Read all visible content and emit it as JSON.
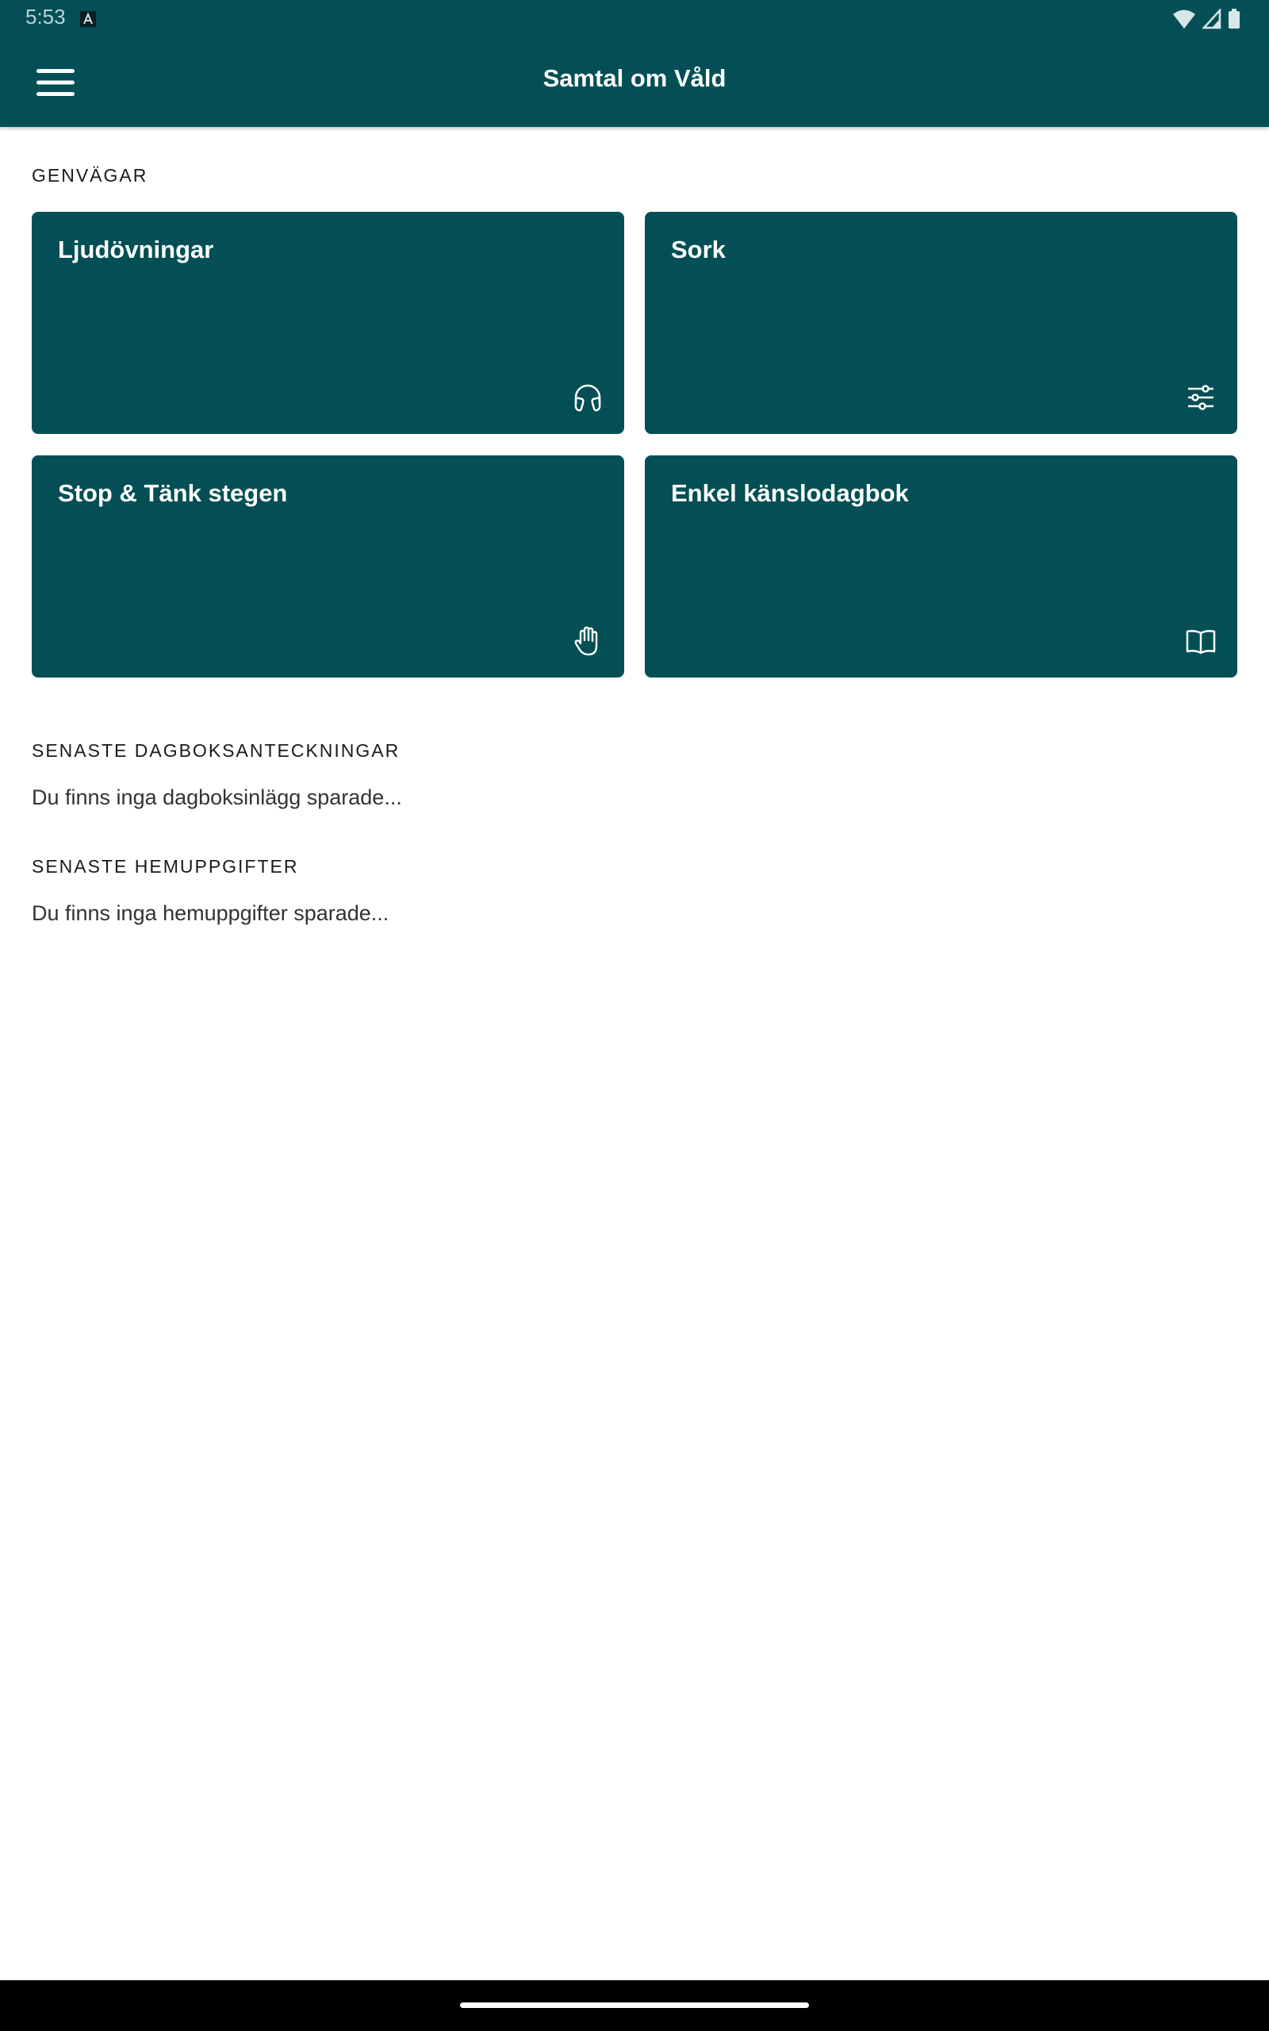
{
  "status_bar": {
    "time": "5:53"
  },
  "app_bar": {
    "title": "Samtal om Våld"
  },
  "shortcuts": {
    "heading": "GENVÄGAR",
    "cards": [
      {
        "label": "Ljudövningar",
        "icon": "headphones-icon"
      },
      {
        "label": "Sork",
        "icon": "sliders-icon"
      },
      {
        "label": "Stop & Tänk stegen",
        "icon": "hand-icon"
      },
      {
        "label": "Enkel känslodagbok",
        "icon": "open-book-icon"
      }
    ]
  },
  "diary": {
    "heading": "SENASTE DAGBOKSANTECKNINGAR",
    "empty_text": "Du finns inga dagboksinlägg sparade..."
  },
  "homework": {
    "heading": "SENASTE HEMUPPGIFTER",
    "empty_text": "Du finns inga hemuppgifter sparade..."
  },
  "colors": {
    "primary": "#034f55",
    "on_primary": "#ffffff",
    "background": "#ffffff",
    "nav_bar": "#000000"
  }
}
